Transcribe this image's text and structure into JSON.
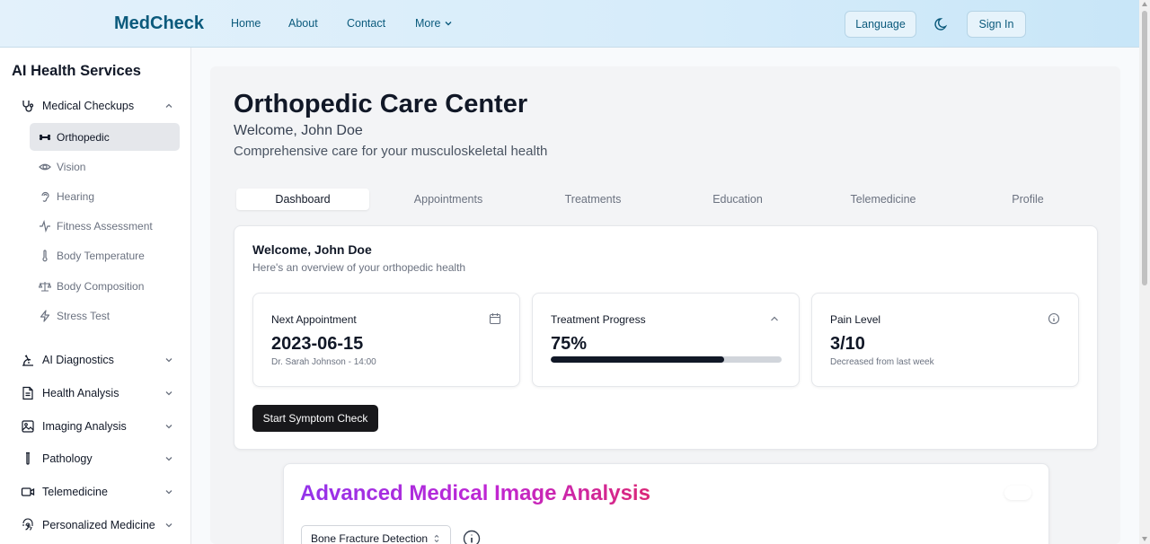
{
  "header": {
    "brand": "MedCheck",
    "nav": [
      "Home",
      "About",
      "Contact",
      "More"
    ],
    "language_label": "Language",
    "signin_label": "Sign In"
  },
  "sidebar": {
    "title": "AI Health Services",
    "group_medical": "Medical Checkups",
    "items": [
      "Orthopedic",
      "Vision",
      "Hearing",
      "Fitness Assessment",
      "Body Temperature",
      "Body Composition",
      "Stress Test"
    ],
    "groups": [
      "AI Diagnostics",
      "Health Analysis",
      "Imaging Analysis",
      "Pathology",
      "Telemedicine",
      "Personalized Medicine"
    ]
  },
  "page": {
    "title": "Orthopedic Care Center",
    "welcome": "Welcome, John Doe",
    "subtitle": "Comprehensive care for your musculoskeletal health"
  },
  "tabs": [
    "Dashboard",
    "Appointments",
    "Treatments",
    "Education",
    "Telemedicine",
    "Profile"
  ],
  "overview": {
    "title": "Welcome, John Doe",
    "description": "Here's an overview of your orthopedic health",
    "next_appt_label": "Next Appointment",
    "next_appt_value": "2023-06-15",
    "next_appt_note": "Dr. Sarah Johnson - 14:00",
    "progress_label": "Treatment Progress",
    "progress_value": "75%",
    "progress_fraction": 0.75,
    "pain_label": "Pain Level",
    "pain_value": "3/10",
    "pain_note": "Decreased from last week",
    "cta_label": "Start Symptom Check"
  },
  "image_analysis": {
    "title": "Advanced Medical Image Analysis",
    "select_value": "Bone Fracture Detection"
  },
  "colors": {
    "brand": "#0b5a7c",
    "accent_gradient_start": "#9333ea",
    "accent_gradient_end": "#db2777",
    "cta": "#18181b"
  }
}
